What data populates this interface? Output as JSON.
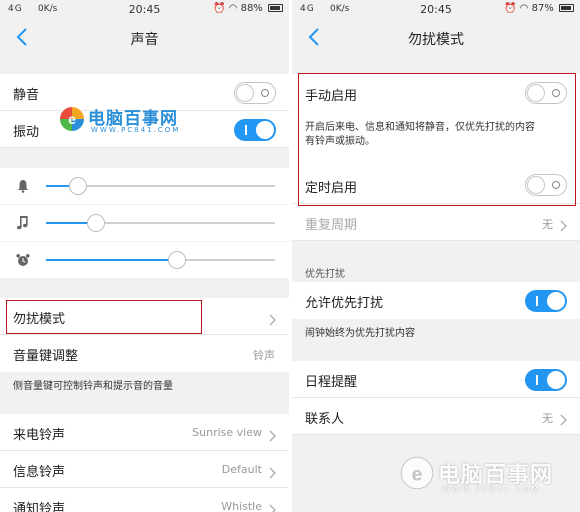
{
  "left": {
    "status": {
      "signal": "4G",
      "speed": "0K/s",
      "time": "20:45",
      "battery": "88%"
    },
    "title": "声音",
    "mute": {
      "label": "静音",
      "on": false
    },
    "vibrate": {
      "label": "振动",
      "on": true
    },
    "volumes": [
      {
        "icon": "bell-icon",
        "level": 0.14
      },
      {
        "icon": "music-note-icon",
        "level": 0.22
      },
      {
        "icon": "alarm-clock-icon",
        "level": 0.57
      }
    ],
    "dnd": {
      "label": "勿扰模式"
    },
    "volume_key": {
      "label": "音量键调整",
      "value": "铃声"
    },
    "volume_key_note": "侧音量键可控制铃声和提示音的音量",
    "ringtone": {
      "label": "来电铃声",
      "value": "Sunrise view"
    },
    "message_tone": {
      "label": "信息铃声",
      "value": "Default"
    },
    "notify_tone": {
      "label": "通知铃声",
      "value": "Whistle"
    }
  },
  "right": {
    "status": {
      "signal": "4G",
      "speed": "0K/s",
      "time": "20:45",
      "battery": "87%"
    },
    "title": "勿扰模式",
    "manual": {
      "label": "手动启用",
      "on": false
    },
    "manual_note_line1": "开启后来电、信息和通知将静音，仅优先打扰的内容",
    "manual_note_line2": "有铃声或振动。",
    "scheduled": {
      "label": "定时启用",
      "on": false
    },
    "repeat": {
      "label": "重复周期",
      "value": "无"
    },
    "priority_section": "优先打扰",
    "allow_priority": {
      "label": "允许优先打扰",
      "on": true
    },
    "alarm_note": "闹钟始终为优先打扰内容",
    "calendar": {
      "label": "日程提醒",
      "on": true
    },
    "contacts": {
      "label": "联系人",
      "value": "无"
    }
  },
  "watermark": {
    "brand": "电脑百事网",
    "url": "WWW.PC841.COM"
  },
  "colors": {
    "accent": "#2196f3",
    "highlight_box": "#c0141c",
    "watermark": "#2a8fd8"
  }
}
